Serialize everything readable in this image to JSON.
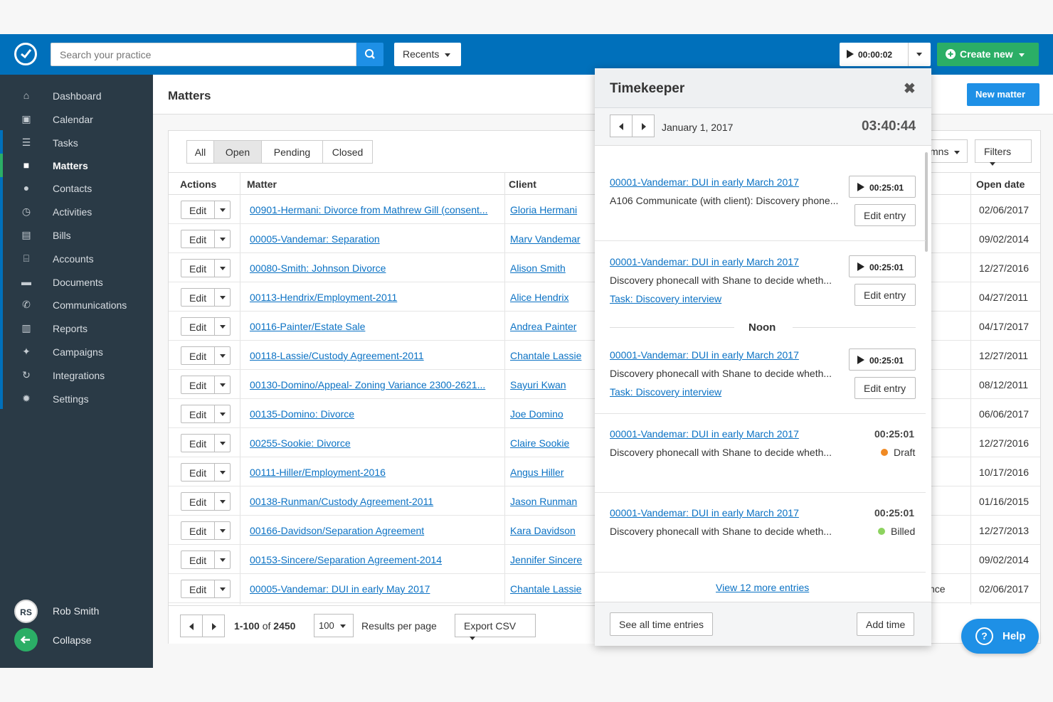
{
  "header": {
    "search_placeholder": "Search your practice",
    "recents_label": "Recents",
    "timer_value": "00:00:02",
    "create_label": "Create new"
  },
  "sidebar": {
    "items": [
      {
        "label": "Dashboard",
        "icon": "home-icon"
      },
      {
        "label": "Calendar",
        "icon": "calendar-icon"
      },
      {
        "label": "Tasks",
        "icon": "list-icon"
      },
      {
        "label": "Matters",
        "icon": "briefcase-icon",
        "active": true
      },
      {
        "label": "Contacts",
        "icon": "person-icon"
      },
      {
        "label": "Activities",
        "icon": "clock-icon"
      },
      {
        "label": "Bills",
        "icon": "money-icon"
      },
      {
        "label": "Accounts",
        "icon": "bank-icon"
      },
      {
        "label": "Documents",
        "icon": "folder-icon"
      },
      {
        "label": "Communications",
        "icon": "phone-icon"
      },
      {
        "label": "Reports",
        "icon": "bar-chart-icon"
      },
      {
        "label": "Campaigns",
        "icon": "campaign-icon"
      },
      {
        "label": "Integrations",
        "icon": "refresh-icon"
      },
      {
        "label": "Settings",
        "icon": "gear-icon"
      }
    ],
    "user_initials": "RS",
    "user_name": "Rob Smith",
    "collapse_label": "Collapse"
  },
  "page": {
    "title": "Matters",
    "new_matter_label": "New matter",
    "tabs": [
      "All",
      "Open",
      "Pending",
      "Closed"
    ],
    "active_tab": "Open",
    "columns_label": "mns",
    "filters_label": "Filters"
  },
  "table": {
    "headers": {
      "actions": "Actions",
      "matter": "Matter",
      "client": "Client",
      "open_date": "Open date"
    },
    "edit_label": "Edit",
    "rows": [
      {
        "matter": "00901-Hermani: Divorce from Mathrew Gill (consent...",
        "client": "Gloria Hermani",
        "open_date": "02/06/2017"
      },
      {
        "matter": "00005-Vandemar: Separation",
        "client": "Marv Vandemar",
        "open_date": "09/02/2014"
      },
      {
        "matter": "00080-Smith: Johnson Divorce",
        "client": "Alison Smith",
        "open_date": "12/27/2016"
      },
      {
        "matter": "00113-Hendrix/Employment-2011",
        "client": "Alice Hendrix",
        "open_date": "04/27/2011"
      },
      {
        "matter": "00116-Painter/Estate Sale",
        "client": "Andrea Painter",
        "open_date": "04/17/2017"
      },
      {
        "matter": "00118-Lassie/Custody Agreement-2011",
        "client": "Chantale Lassie",
        "open_date": "12/27/2011"
      },
      {
        "matter": "00130-Domino/Appeal- Zoning Variance 2300-2621...",
        "client": "Sayuri Kwan",
        "open_date": "08/12/2011"
      },
      {
        "matter": "00135-Domino: Divorce",
        "client": "Joe Domino",
        "open_date": "06/06/2017"
      },
      {
        "matter": "00255-Sookie: Divorce",
        "client": "Claire Sookie",
        "open_date": "12/27/2016"
      },
      {
        "matter": "00111-Hiller/Employment-2016",
        "client": "Angus Hiller",
        "open_date": "10/17/2016"
      },
      {
        "matter": "00138-Runman/Custody Agreement-2011",
        "client": "Jason Runman",
        "open_date": "01/16/2015"
      },
      {
        "matter": "00166-Davidson/Separation Agreement",
        "client": "Kara Davidson",
        "open_date": "12/27/2013"
      },
      {
        "matter": "00153-Sincere/Separation Agreement-2014",
        "client": "Jennifer Sincere",
        "open_date": "09/02/2014"
      },
      {
        "matter": "00005-Vandemar: DUI in early May 2017",
        "client": "Chantale Lassie",
        "open_date": "02/06/2017",
        "extra": "nce"
      }
    ]
  },
  "pagination": {
    "range": "1-100",
    "of_label": "of",
    "total": "2450",
    "per_page": "100",
    "per_page_label": "Results per page",
    "export_label": "Export CSV"
  },
  "timekeeper": {
    "title": "Timekeeper",
    "date": "January 1, 2017",
    "total": "03:40:44",
    "noon_label": "Noon",
    "entries": [
      {
        "matter": "00001-Vandemar: DUI in early March 2017",
        "desc": "A106 Communicate (with client): Discovery phone...",
        "duration": "00:25:01",
        "edit_label": "Edit entry"
      },
      {
        "matter": "00001-Vandemar: DUI in early March 2017",
        "desc": "Discovery phonecall with Shane to decide wheth...",
        "task": "Task: Discovery interview",
        "duration": "00:25:01",
        "edit_label": "Edit entry"
      },
      {
        "matter": "00001-Vandemar: DUI in early March 2017",
        "desc": "Discovery phonecall with Shane to decide wheth...",
        "task": "Task: Discovery interview",
        "duration": "00:25:01",
        "edit_label": "Edit entry"
      },
      {
        "matter": "00001-Vandemar: DUI in early March 2017",
        "desc": "Discovery phonecall with Shane to decide wheth...",
        "duration": "00:25:01",
        "status": "Draft",
        "status_color": "#f08a24"
      },
      {
        "matter": "00001-Vandemar: DUI in early March 2017",
        "desc": "Discovery phonecall with Shane to decide wheth...",
        "duration": "00:25:01",
        "status": "Billed",
        "status_color": "#8dd35f"
      }
    ],
    "more_label": "View 12 more entries",
    "see_all_label": "See all time entries",
    "add_time_label": "Add time"
  },
  "help_label": "Help",
  "colors": {
    "brand": "#0070bb",
    "sidebar": "#2a3a46",
    "accent_green": "#2bae66",
    "link": "#0b72c4"
  }
}
